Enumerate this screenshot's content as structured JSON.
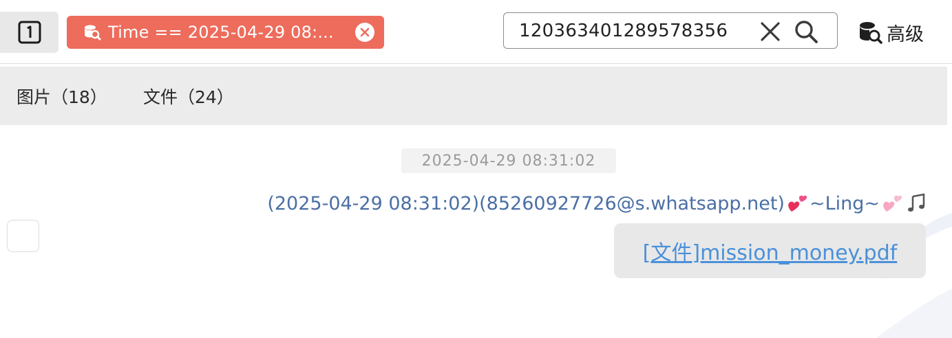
{
  "toolbar": {
    "index_icon": "numbered-square-1-icon",
    "filter_chip": {
      "icon": "database-search-icon",
      "text": "Time == 2025-04-29 08:...",
      "close_icon": "close-circle-icon",
      "color": "#ed6c5c"
    },
    "search": {
      "value": "120363401289578356",
      "clear_icon": "close-icon",
      "search_icon": "search-icon"
    },
    "advanced": {
      "icon": "database-search-icon",
      "label": "高级"
    }
  },
  "tabs": [
    {
      "label": "图片（18）"
    },
    {
      "label": "文件（24）"
    }
  ],
  "messages": [
    {
      "time_divider": "2025-04-29 08:31:02",
      "sender_text": "(2025-04-29 08:31:02)(85260927726@s.whatsapp.net)",
      "sender_name": "~Ling~",
      "sender_emojis": [
        "two-hearts-emoji",
        "two-hearts-emoji",
        "musical-notes-emoji"
      ],
      "file_link": "[文件]mission_money.pdf",
      "link_color": "#4a90d9"
    }
  ]
}
